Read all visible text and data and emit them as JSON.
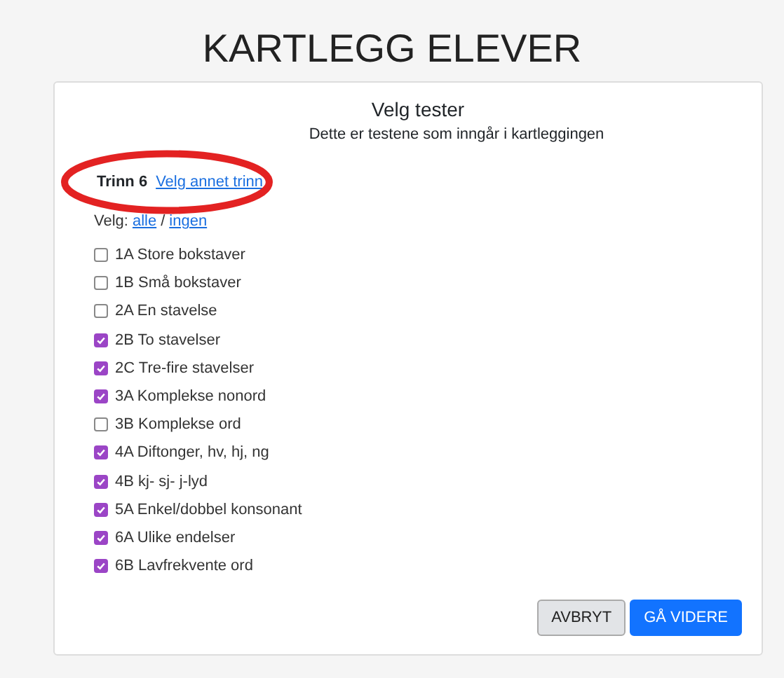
{
  "page_title": "KARTLEGG ELEVER",
  "card": {
    "heading": "Velg tester",
    "subtitle": "Dette er testene som inngår i kartleggingen",
    "grade": {
      "label": "Trinn 6",
      "link": "Velg annet trinn",
      "highlighted": true
    },
    "select": {
      "label": "Velg:",
      "all": "alle",
      "separator": "/",
      "none": "ingen"
    },
    "tests": [
      {
        "label": "1A Store bokstaver",
        "checked": false
      },
      {
        "label": "1B Små bokstaver",
        "checked": false
      },
      {
        "label": "2A En stavelse",
        "checked": false
      },
      {
        "label": "2B To stavelser",
        "checked": true
      },
      {
        "label": "2C Tre-fire stavelser",
        "checked": true
      },
      {
        "label": "3A Komplekse nonord",
        "checked": true
      },
      {
        "label": "3B Komplekse ord",
        "checked": false
      },
      {
        "label": "4A Diftonger, hv, hj, ng",
        "checked": true
      },
      {
        "label": "4B kj- sj- j-lyd",
        "checked": true
      },
      {
        "label": "5A Enkel/dobbel konsonant",
        "checked": true
      },
      {
        "label": "6A Ulike endelser",
        "checked": true
      },
      {
        "label": "6B Lavfrekvente ord",
        "checked": true
      }
    ],
    "buttons": [
      {
        "label": "AVBRYT",
        "kind": "secondary"
      },
      {
        "label": "GÅ VIDERE",
        "kind": "primary"
      }
    ]
  }
}
